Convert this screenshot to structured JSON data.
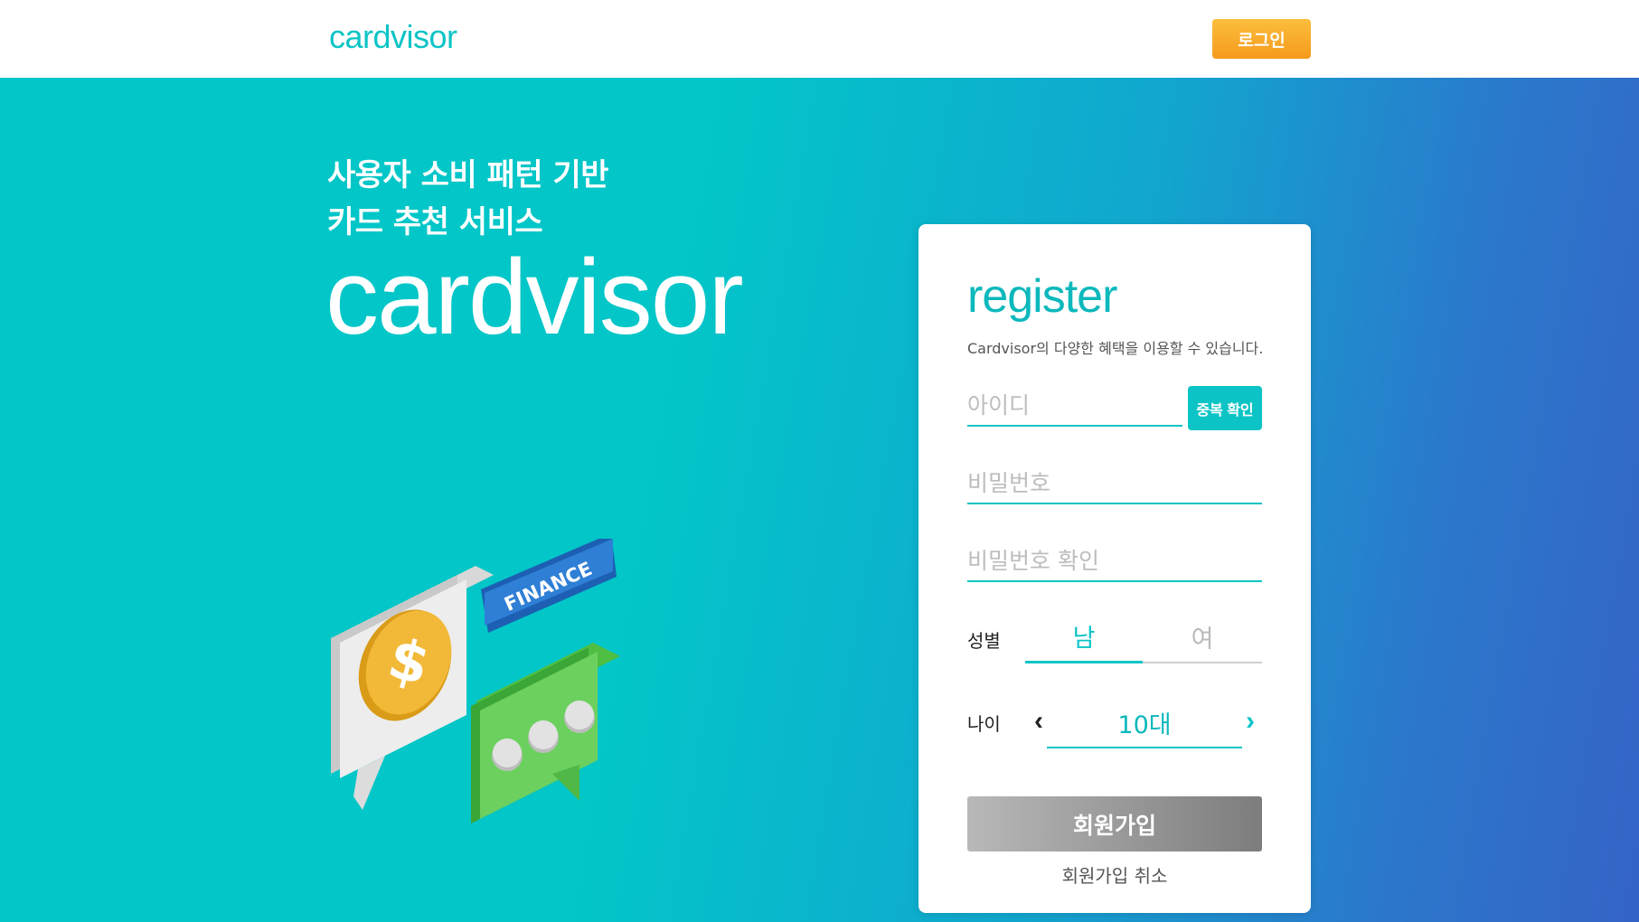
{
  "header": {
    "logo": "cardvisor",
    "login_label": "로그인"
  },
  "hero": {
    "headline_line1": "사용자 소비 패턴 기반",
    "headline_line2": "카드 추천 서비스",
    "logo": "cardvisor",
    "illustration_label": "FINANCE",
    "illustration_coin_symbol": "$"
  },
  "register": {
    "title": "register",
    "subtitle": "Cardvisor의 다양한 혜택을 이용할 수 있습니다.",
    "id_placeholder": "아이디",
    "duplicate_check_label": "중복 확인",
    "password_placeholder": "비밀번호",
    "password_confirm_placeholder": "비밀번호 확인",
    "gender_label": "성별",
    "gender_options": [
      "남",
      "여"
    ],
    "gender_selected": "남",
    "age_label": "나이",
    "age_value": "10대",
    "submit_label": "회원가입",
    "cancel_label": "회원가입 취소"
  },
  "colors": {
    "accent": "#0cc4c6",
    "login_button": "#f8ab2c",
    "submit_button": "#9a9a9a",
    "hero_gradient_start": "#02c6c8",
    "hero_gradient_end": "#3563c7"
  }
}
